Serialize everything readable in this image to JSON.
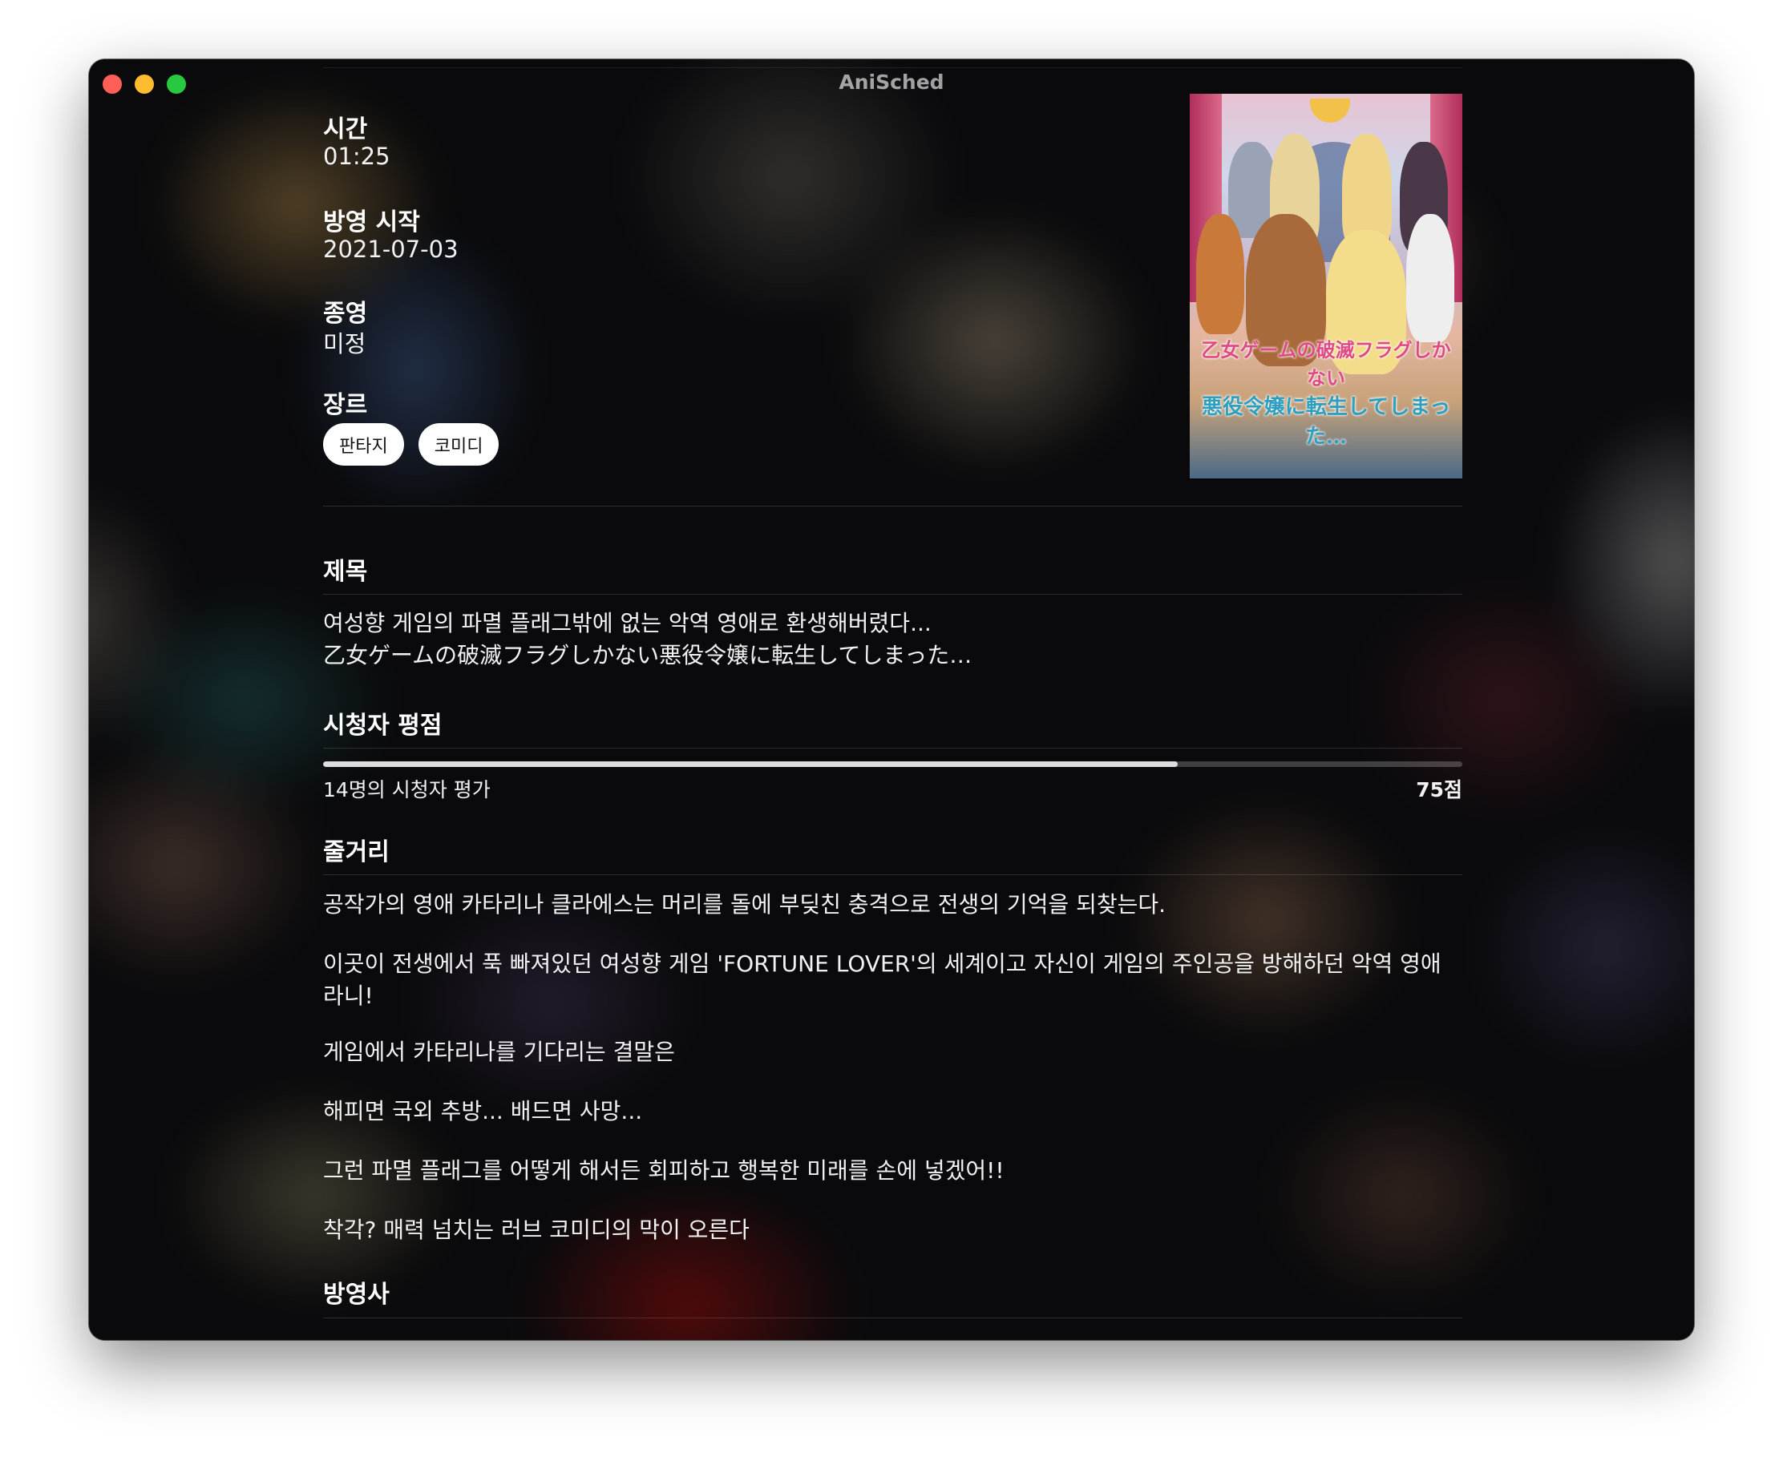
{
  "window": {
    "title": "AniSched",
    "controls": {
      "close": "close",
      "minimize": "minimize",
      "zoom": "zoom"
    }
  },
  "info": {
    "time_label": "시간",
    "time_value": "01:25",
    "start_label": "방영 시작",
    "start_value": "2021-07-03",
    "end_label": "종영",
    "end_value": "미정",
    "genre_label": "장르",
    "genres": [
      "판타지",
      "코미디"
    ]
  },
  "poster": {
    "logo_line1": "乙女ゲームの破滅フラグしかない",
    "logo_line2": "悪役令嬢に転生してしまった…"
  },
  "title_section": {
    "label": "제목",
    "korean": "여성향 게임의 파멸 플래그밖에 없는 악역 영애로 환생해버렸다...",
    "japanese": "乙女ゲームの破滅フラグしかない悪役令嬢に転生してしまった…"
  },
  "rating": {
    "label": "시청자 평점",
    "count_text": "14명의 시청자 평가",
    "score_text": "75점",
    "fraction": 0.75
  },
  "synopsis": {
    "label": "줄거리",
    "paragraphs": [
      "공작가의 영애 카타리나 클라에스는 머리를 돌에 부딪친 충격으로 전생의 기억을 되찾는다.",
      "이곳이 전생에서 푹 빠져있던 여성향 게임 'FORTUNE LOVER'의 세계이고  자신이 게임의 주인공을 방해하던 악역 영애라니!",
      "게임에서 카타리나를 기다리는 결말은",
      "해피면 국외 추방... 배드면 사망...",
      "그런 파멸 플래그를 어떻게 해서든 회피하고  행복한 미래를 손에 넣겠어!!",
      "착각? 매력 넘치는 러브 코미디의 막이 오른다"
    ]
  },
  "broadcaster": {
    "label": "방영사"
  }
}
